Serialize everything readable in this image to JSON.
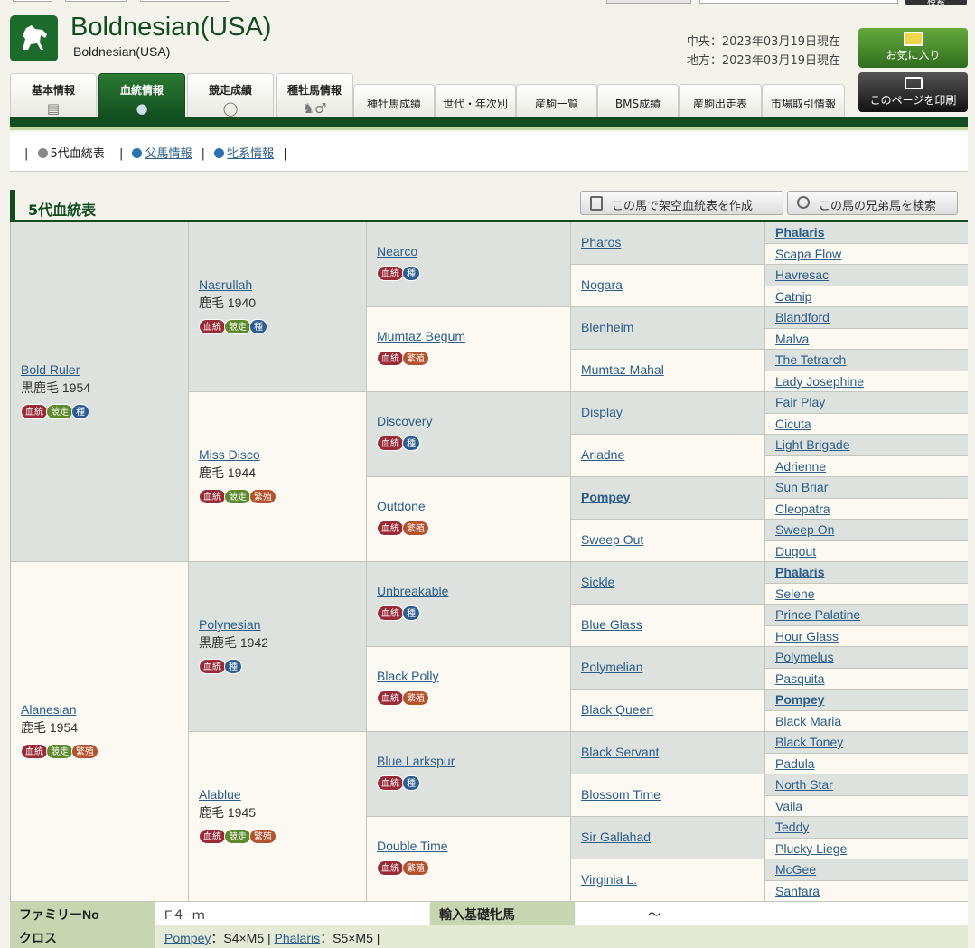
{
  "top": {
    "search_label": "検索"
  },
  "header": {
    "horse_name": "Boldnesian(USA)",
    "horse_sub": "Boldnesian(USA)",
    "date_central": "中央：2023年03月19日現在",
    "date_local": "地方：2023年03月19日現在",
    "fav_label": "お気に入り",
    "print_label": "このページを印刷"
  },
  "tabs": [
    {
      "label": "基本情報",
      "icon": "document-icon"
    },
    {
      "label": "血統情報",
      "icon": "drop-icon"
    },
    {
      "label": "競走成績",
      "icon": "track-icon"
    },
    {
      "label": "種牡馬情報",
      "icon": "horse-male-icon"
    },
    {
      "label": "種牡馬成績"
    },
    {
      "label": "世代・年次別"
    },
    {
      "label": "産駒一覧"
    },
    {
      "label": "BMS成績"
    },
    {
      "label": "産駒出走表"
    },
    {
      "label": "市場取引情報"
    }
  ],
  "subnav": {
    "current": "5代血統表",
    "sire_link": "父馬情報",
    "line_link": "牝系情報"
  },
  "section": {
    "title": "5代血統表",
    "btn_create": "この馬で架空血統表を作成",
    "btn_siblings": "この馬の兄弟馬を検索"
  },
  "badge_labels": {
    "k": "血統",
    "s": "競走",
    "t": "種",
    "h": "繁殖"
  },
  "pedigree": {
    "gen1": [
      {
        "name": "Bold Ruler",
        "info": "黒鹿毛 1954"
      },
      {
        "name": "Alanesian",
        "info": "鹿毛 1954"
      }
    ],
    "gen2": [
      {
        "name": "Nasrullah",
        "info": "鹿毛 1940"
      },
      {
        "name": "Miss Disco",
        "info": "鹿毛 1944"
      },
      {
        "name": "Polynesian",
        "info": "黒鹿毛 1942"
      },
      {
        "name": "Alablue",
        "info": "鹿毛 1945"
      }
    ],
    "gen3": [
      {
        "name": "Nearco"
      },
      {
        "name": "Mumtaz Begum"
      },
      {
        "name": "Discovery"
      },
      {
        "name": "Outdone"
      },
      {
        "name": "Unbreakable"
      },
      {
        "name": "Black Polly"
      },
      {
        "name": "Blue Larkspur"
      },
      {
        "name": "Double Time"
      }
    ],
    "gen4": [
      {
        "name": "Pharos"
      },
      {
        "name": "Nogara"
      },
      {
        "name": "Blenheim"
      },
      {
        "name": "Mumtaz Mahal"
      },
      {
        "name": "Display"
      },
      {
        "name": "Ariadne"
      },
      {
        "name": "Pompey"
      },
      {
        "name": "Sweep Out"
      },
      {
        "name": "Sickle"
      },
      {
        "name": "Blue Glass"
      },
      {
        "name": "Polymelian"
      },
      {
        "name": "Black Queen"
      },
      {
        "name": "Black Servant"
      },
      {
        "name": "Blossom Time"
      },
      {
        "name": "Sir Gallahad"
      },
      {
        "name": "Virginia L."
      }
    ],
    "gen5": [
      {
        "name": "Phalaris"
      },
      {
        "name": "Scapa Flow"
      },
      {
        "name": "Havresac"
      },
      {
        "name": "Catnip"
      },
      {
        "name": "Blandford"
      },
      {
        "name": "Malva"
      },
      {
        "name": "The Tetrarch"
      },
      {
        "name": "Lady Josephine"
      },
      {
        "name": "Fair Play"
      },
      {
        "name": "Cicuta"
      },
      {
        "name": "Light Brigade"
      },
      {
        "name": "Adrienne"
      },
      {
        "name": "Sun Briar"
      },
      {
        "name": "Cleopatra"
      },
      {
        "name": "Sweep On"
      },
      {
        "name": "Dugout"
      },
      {
        "name": "Phalaris"
      },
      {
        "name": "Selene"
      },
      {
        "name": "Prince Palatine"
      },
      {
        "name": "Hour Glass"
      },
      {
        "name": "Polymelus"
      },
      {
        "name": "Pasquita"
      },
      {
        "name": "Pompey"
      },
      {
        "name": "Black Maria"
      },
      {
        "name": "Black Toney"
      },
      {
        "name": "Padula"
      },
      {
        "name": "North Star"
      },
      {
        "name": "Vaila"
      },
      {
        "name": "Teddy"
      },
      {
        "name": "Plucky Liege"
      },
      {
        "name": "McGee"
      },
      {
        "name": "Sanfara"
      }
    ]
  },
  "footer": {
    "family_label": "ファミリーNo",
    "family_value": "F４−ｍ",
    "import_label": "輸入基礎牝馬",
    "import_value": "〜",
    "cross_label": "クロス",
    "cross1_name": "Pompey",
    "cross1_val": "：S4×M5 |",
    "cross2_name": "Phalaris",
    "cross2_val": "：S5×M5 |"
  },
  "colors": {
    "brand_green": "#114d1f",
    "link": "#2a5d8a"
  }
}
